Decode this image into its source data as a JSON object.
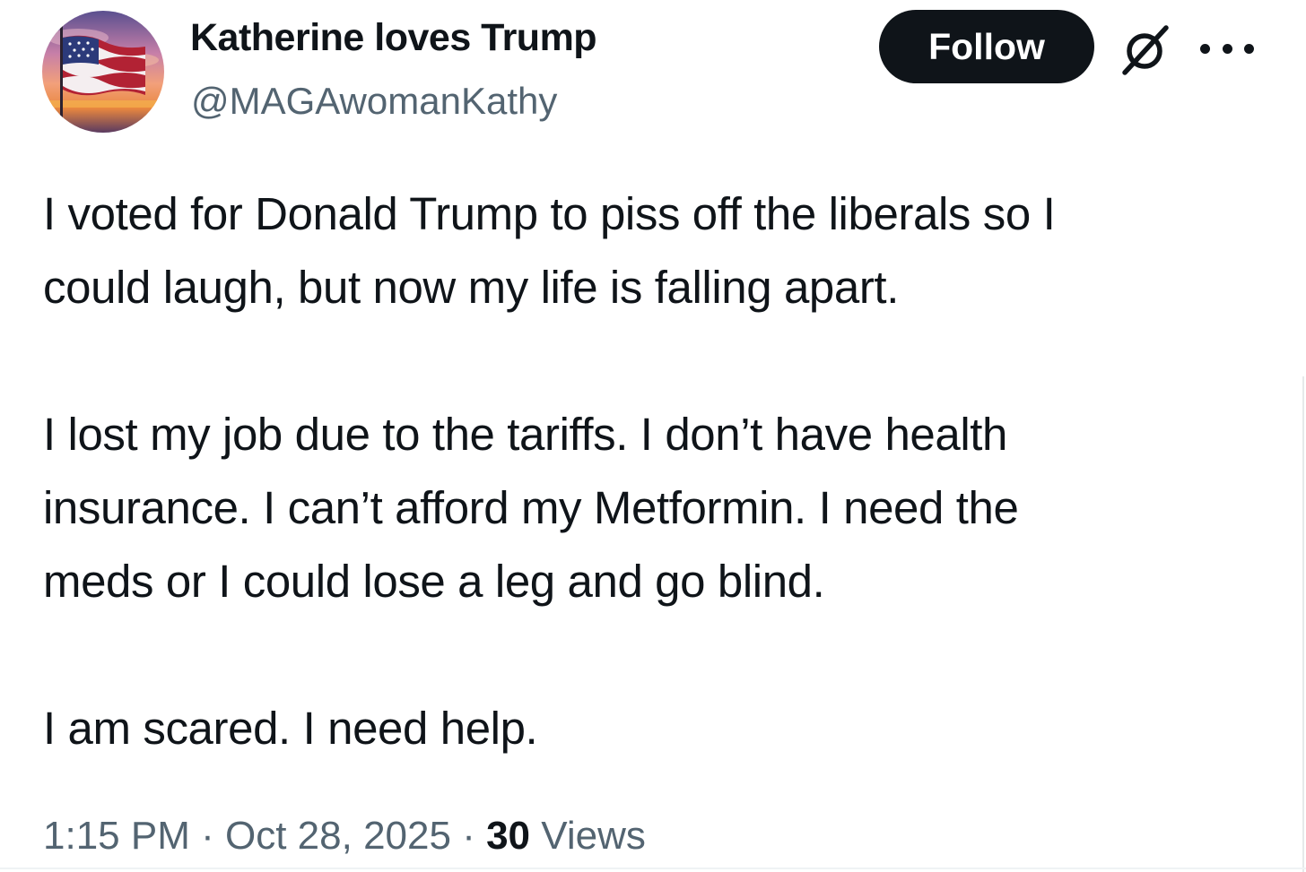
{
  "author": {
    "display_name": "Katherine loves Trump",
    "handle": "@MAGAwomanKathy",
    "avatar_icon": "american-flag-sunset-avatar"
  },
  "actions": {
    "follow_label": "Follow",
    "grok_icon": "grok-icon",
    "more_icon": "more-options-icon"
  },
  "post": {
    "paragraphs": [
      "I voted for Donald Trump to piss off the liberals so I\ncould laugh, but now my life is falling apart.",
      "I lost my job due to the tariffs. I don’t have health\ninsurance. I can’t afford my Metformin. I need the\nmeds or I could lose a leg and go blind.",
      "I am scared. I need help."
    ]
  },
  "meta": {
    "time": "1:15 PM",
    "separator": "·",
    "date": "Oct 28, 2025",
    "views_count": "30",
    "views_label": "Views"
  },
  "colors": {
    "text_primary": "#0f1419",
    "text_secondary": "#536471",
    "follow_bg": "#0f1419",
    "follow_text": "#ffffff"
  }
}
